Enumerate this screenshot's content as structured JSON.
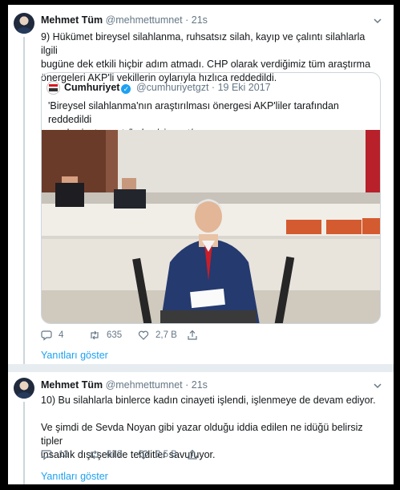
{
  "tweets": [
    {
      "name": "Mehmet Tüm",
      "handle": "@mehmettumnet",
      "dot": "·",
      "time": "21s",
      "lines": [
        "9) Hükümet bireysel silahlanma, ruhsatsız silah, kayıp ve çalıntı silahlarla ilgili",
        "bugüne dek etkili hiçbir adım atmadı. CHP olarak verdiğimiz tüm araştırma",
        "önergeleri AKP'li vekillerin oylarıyla hızlıca reddedildi."
      ],
      "quote": {
        "name": "Cumhuriyet",
        "handle": "@cumhuriyetgzt",
        "dot": "·",
        "date": "19 Eki 2017",
        "lines": [
          "'Bireysel silahlanma'nın araştırılması önergesi AKP'liler tarafından reddedildi",
          "cumhuriyet.com.tr/haber/siyaset/..."
        ]
      },
      "stats": {
        "replies": "4",
        "retweets": "635",
        "likes": "2,7 B"
      },
      "show_replies": "Yanıtları göster"
    },
    {
      "name": "Mehmet Tüm",
      "handle": "@mehmettumnet",
      "dot": "·",
      "time": "21s",
      "lines": [
        "10) Bu silahlarla binlerce kadın cinayeti işlendi, işlenmeye de devam ediyor.",
        "",
        "Ve şimdi de Sevda Noyan gibi yazar olduğu iddia edilen ne idüğü belirsiz tipler",
        "insanlık dışı şekilde tehditler savuruyor."
      ],
      "stats": {
        "replies": "13",
        "retweets": "612",
        "likes": "3,5 B"
      },
      "show_replies": "Yanıtları göster"
    }
  ],
  "colors": {
    "accent": "#1da1f2",
    "text": "#14171a",
    "muted": "#657786",
    "border": "#ccd6dd",
    "retweet_green": "#17bf63"
  }
}
